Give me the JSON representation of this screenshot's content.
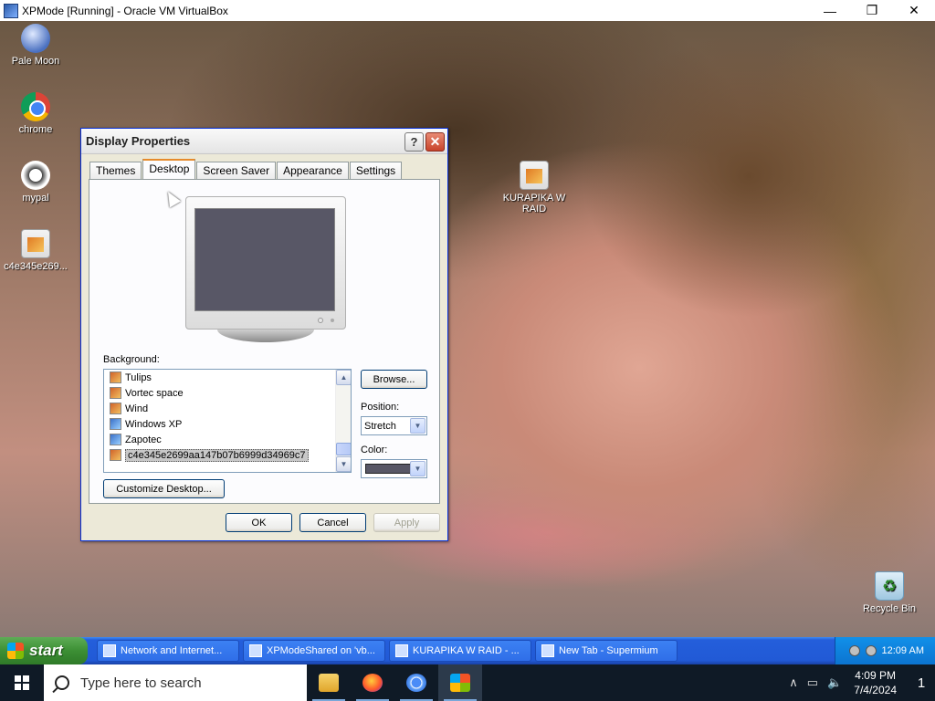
{
  "host": {
    "title": "XPMode [Running] - Oracle VM VirtualBox",
    "controls": {
      "minimize": "—",
      "maximize": "❐",
      "close": "✕"
    }
  },
  "desktop_icons": [
    {
      "label": "Pale Moon",
      "icon": "pale-moon-icon"
    },
    {
      "label": "chrome",
      "icon": "chrome-icon"
    },
    {
      "label": "mypal",
      "icon": "mypal-icon"
    },
    {
      "label": "c4e345e269...",
      "icon": "image-file-icon"
    },
    {
      "label": "KURAPIKA W RAID",
      "icon": "image-file-icon"
    },
    {
      "label": "Recycle Bin",
      "icon": "recycle-bin-icon"
    }
  ],
  "dialog": {
    "title": "Display Properties",
    "help": "?",
    "close": "✕",
    "tabs": [
      "Themes",
      "Desktop",
      "Screen Saver",
      "Appearance",
      "Settings"
    ],
    "active_tab": "Desktop",
    "background_label": "Background:",
    "background_items": [
      "Tulips",
      "Vortec space",
      "Wind",
      "Windows XP",
      "Zapotec",
      "c4e345e2699aa147b07b6999d34969c7"
    ],
    "selected_background": "c4e345e2699aa147b07b6999d34969c7",
    "browse_label": "Browse...",
    "position_label": "Position:",
    "position_value": "Stretch",
    "color_label": "Color:",
    "color_value": "#585766",
    "customize_label": "Customize Desktop...",
    "ok_label": "OK",
    "cancel_label": "Cancel",
    "apply_label": "Apply"
  },
  "xp_taskbar": {
    "start_label": "start",
    "tasks": [
      "Network and Internet...",
      "XPModeShared on 'vb...",
      "KURAPIKA W RAID - ...",
      "New Tab - Supermium"
    ],
    "clock": "12:09 AM"
  },
  "w10_taskbar": {
    "search_placeholder": "Type here to search",
    "apps": [
      "file-explorer-icon",
      "firefox-icon",
      "chromium-icon",
      "xp-mode-icon"
    ],
    "tray_up": "∧",
    "tray_network": "▭",
    "tray_volume": "🔈",
    "time": "4:09 PM",
    "date": "7/4/2024",
    "notifications": "1"
  },
  "colors": {
    "xp_blue": "#245edb",
    "xp_start_green": "#3c8f34",
    "dialog_bg": "#ece9d8",
    "desktop_preview": "#585766"
  }
}
